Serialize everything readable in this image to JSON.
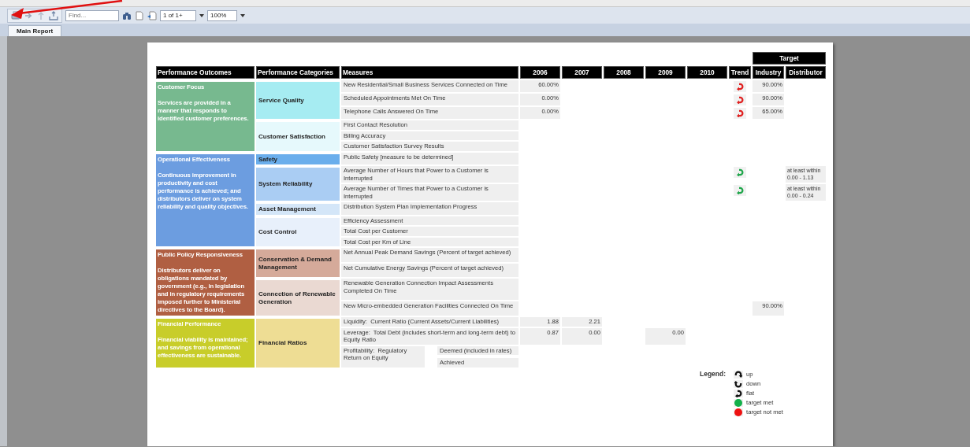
{
  "toolbar": {
    "find": {
      "placeholder": "Find..."
    },
    "page": {
      "value": "1 of 1+"
    },
    "zoom": {
      "value": "100%"
    }
  },
  "tabs": [
    {
      "label": "Main Report",
      "selected": true
    }
  ],
  "report": {
    "headers": {
      "outcomes": "Performance Outcomes",
      "categories": "Performance Categories",
      "measures": "Measures",
      "years": [
        "2006",
        "2007",
        "2008",
        "2009",
        "2010"
      ],
      "trend": "Trend",
      "target": "Target",
      "industry": "Industry",
      "distributor": "Distributor"
    },
    "outcomes": [
      {
        "title": "Customer Focus",
        "description": "Services are provided in a manner that responds to identified customer preferences.",
        "color": "#77b98f",
        "categories": [
          {
            "name": "Service Quality",
            "color": "#a6ecf2",
            "measures": [
              {
                "kind": "single",
                "text": "New Residential/Small Business Services Connected on Time",
                "year_1": "60.00%",
                "trend": {
                  "kind": "flat",
                  "met": false
                },
                "industry": "90.00%"
              },
              {
                "kind": "single",
                "text": "Scheduled Appointments Met On Time",
                "year_1": "0.00%",
                "trend": {
                  "kind": "flat",
                  "met": false
                },
                "industry": "90.00%"
              },
              {
                "kind": "single",
                "text": "Telephone Calls Answered On Time",
                "year_1": "0.00%",
                "trend": {
                  "kind": "flat",
                  "met": false
                },
                "industry": "65.00%"
              }
            ]
          },
          {
            "name": "Customer Satisfaction",
            "color": "#e6f9fc",
            "measures": [
              {
                "kind": "single",
                "text": "First Contact Resolution"
              },
              {
                "kind": "single",
                "text": "Billing Accuracy"
              },
              {
                "kind": "single",
                "text": "Customer Satisfaction Survey Results"
              }
            ]
          }
        ]
      },
      {
        "title": "Operational Effectiveness",
        "description": "Continuous improvement in productivity and cost performance is achieved; and distributors deliver on system reliability and quality objectives.",
        "color": "#6c9de0",
        "categories": [
          {
            "name": "Safety",
            "color": "#6aaeec",
            "measures": [
              {
                "kind": "single",
                "text": "Public Safety [measure to be determined]"
              }
            ]
          },
          {
            "name": "System Reliability",
            "color": "#aacdf3",
            "measures": [
              {
                "kind": "single",
                "text": "Average Number of Hours that Power to a Customer is Interrupted",
                "trend": {
                  "kind": "flat",
                  "met": true
                },
                "distributor": "at least within\n0.00 - 1.13"
              },
              {
                "kind": "single",
                "text": "Average Number of Times that Power to a Customer is Interrupted",
                "trend": {
                  "kind": "flat",
                  "met": true
                },
                "distributor": "at least within\n0.00 - 0.24"
              }
            ]
          },
          {
            "name": "Asset Management",
            "color": "#d4e6f8",
            "measures": [
              {
                "kind": "single",
                "text": "Distribution System Plan Implementation Progress"
              }
            ]
          },
          {
            "name": "Cost Control",
            "color": "#e8f0fb",
            "measures": [
              {
                "kind": "single",
                "text": "Efficiency Assessment"
              },
              {
                "kind": "single",
                "text": "Total Cost per Customer"
              },
              {
                "kind": "single",
                "text": "Total Cost per Km of Line"
              }
            ]
          }
        ]
      },
      {
        "title": "Public Policy Responsiveness",
        "description": "Distributors deliver on obligations mandated by government (e.g., in legislation and in regulatory requirements imposed further to Ministerial directives to the Board).",
        "color": "#b05f42",
        "categories": [
          {
            "name": "Conservation & Demand Management",
            "color": "#d5aa9a",
            "measures": [
              {
                "kind": "single",
                "text": "Net Annual Peak Demand Savings (Percent of target achieved)"
              },
              {
                "kind": "single",
                "text": "Net Cumulative Energy Savings (Percent of target achieved)"
              }
            ]
          },
          {
            "name": "Connection of Renewable Generation",
            "color": "#ead9d2",
            "measures": [
              {
                "kind": "single",
                "text": "Renewable Generation Connection Impact Assessments Completed On Time"
              },
              {
                "kind": "single",
                "text": "New Micro-embedded Generation Facilities Connected On Time",
                "industry": "90.00%"
              }
            ]
          }
        ]
      },
      {
        "title": "Financial Performance",
        "description": "Financial viability is maintained; and savings from operational effectiveness are sustainable.",
        "color": "#c8cd2a",
        "categories": [
          {
            "name": "Financial Ratios",
            "color": "#eedd94",
            "measures": [
              {
                "kind": "single",
                "text": "Liquidity:  Current Ratio (Current Assets/Current Liabilities)",
                "year_1": "1.88",
                "year_2": "2.21"
              },
              {
                "kind": "single",
                "text": "Leverage:  Total Debt (includes short-term and long-term debt) to Equity Ratio",
                "year_1": "0.87",
                "year_2": "0.00",
                "year_4": "0.00"
              },
              {
                "kind": "split",
                "text": "Profitability:  Regulatory Return on Equity",
                "parts": [
                  "Deemed (included in rates)",
                  "Achieved"
                ]
              }
            ]
          }
        ]
      }
    ],
    "legend": {
      "title": "Legend:",
      "items": [
        {
          "kind": "up",
          "label": "up"
        },
        {
          "kind": "down",
          "label": "down"
        },
        {
          "kind": "flat",
          "label": "flat"
        },
        {
          "kind": "dot",
          "color": "#12b04a",
          "label": "target met"
        },
        {
          "kind": "dot",
          "color": "#ee1111",
          "label": "target not met"
        }
      ]
    }
  }
}
